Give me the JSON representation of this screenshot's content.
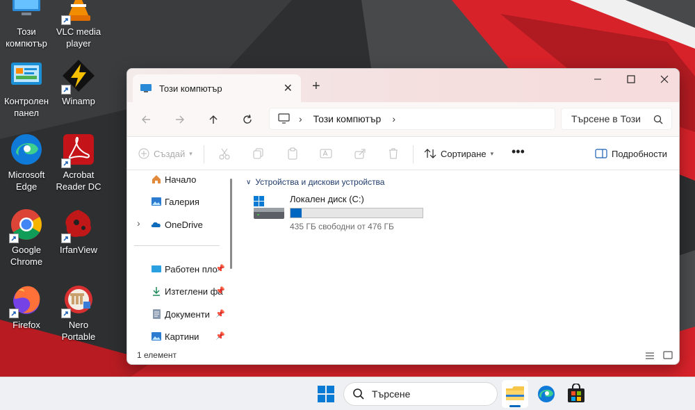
{
  "desktop": {
    "icons": [
      {
        "label": "Този компютър",
        "icon": "computer-icon"
      },
      {
        "label": "VLC media player",
        "icon": "vlc-icon"
      },
      {
        "label": "Контролен панел",
        "icon": "control-panel-icon"
      },
      {
        "label": "Winamp",
        "icon": "winamp-icon"
      },
      {
        "label": "Microsoft Edge",
        "icon": "edge-icon"
      },
      {
        "label": "Acrobat Reader DC",
        "icon": "acrobat-icon"
      },
      {
        "label": "Google Chrome",
        "icon": "chrome-icon"
      },
      {
        "label": "IrfanView",
        "icon": "irfanview-icon"
      },
      {
        "label": "Firefox",
        "icon": "firefox-icon"
      },
      {
        "label": "Nero Portable",
        "icon": "nero-icon"
      }
    ]
  },
  "window": {
    "tab_title": "Този компютър",
    "address": "Този компютър",
    "search_placeholder": "Търсене в Този",
    "toolbar": {
      "new_label": "Създай",
      "sort_label": "Сортиране",
      "details_label": "Подробности"
    },
    "sidebar": {
      "items": [
        {
          "label": "Начало"
        },
        {
          "label": "Галерия"
        },
        {
          "label": "OneDrive"
        },
        {
          "label": "Работен пло"
        },
        {
          "label": "Изтеглени фа"
        },
        {
          "label": "Документи"
        },
        {
          "label": "Картини"
        }
      ]
    },
    "main": {
      "section_title": "Устройства и дискови устройства",
      "drive": {
        "name": "Локален диск (C:)",
        "free_text": "435 ГБ свободни от 476 ГБ",
        "used_fraction": 0.086
      }
    },
    "status": "1 елемент"
  },
  "taskbar": {
    "search_placeholder": "Търсене"
  },
  "colors": {
    "accent": "#0067c0",
    "wallpaper_red": "#e0262b",
    "wallpaper_dark": "#3a3a3c"
  }
}
